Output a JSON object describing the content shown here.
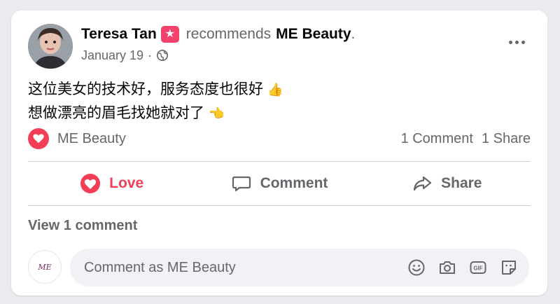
{
  "post": {
    "author": "Teresa Tan",
    "verb": "recommends",
    "page": "ME Beauty",
    "punct": ".",
    "date": "January 19",
    "meta_sep": "·",
    "text_line1": "这位美女的技术好，服务态度也很好",
    "text_line2": "想做漂亮的眉毛找她就对了",
    "emoji1": "👍",
    "emoji2": "👈"
  },
  "reactions": {
    "reactor": "ME Beauty",
    "comments": "1 Comment",
    "shares": "1 Share"
  },
  "actions": {
    "love": "Love",
    "comment": "Comment",
    "share": "Share"
  },
  "comments": {
    "view_label": "View 1 comment",
    "placeholder": "Comment as ME Beauty",
    "page_avatar_text": "ME"
  },
  "colors": {
    "love": "#f33e58",
    "badge": "#f2416b",
    "secondary_text": "#65676b"
  },
  "icons": [
    "recommend-badge-icon",
    "globe-icon",
    "more-options-icon",
    "heart-icon",
    "comment-icon",
    "share-icon",
    "emoji-icon",
    "camera-icon",
    "gif-icon",
    "sticker-icon"
  ]
}
